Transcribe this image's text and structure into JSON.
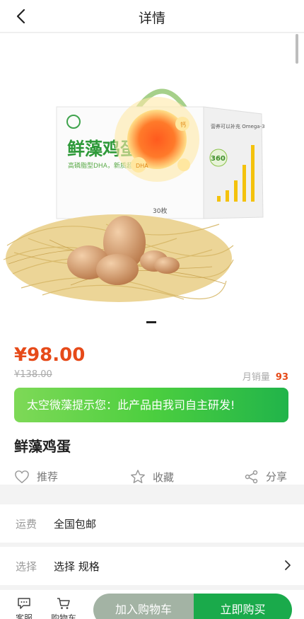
{
  "nav": {
    "title": "详情"
  },
  "product": {
    "price": "¥98.00",
    "old_price": "¥138.00",
    "sales_label": "月销量",
    "sales_count": "93",
    "notice": "太空微藻提示您：此产品由我司自主研发!",
    "name": "鲜藻鸡蛋"
  },
  "image_text": {
    "brand": "鲜藻鸡蛋",
    "tagline": "高磷脂型DHA，新质超黄金",
    "dha": "DHA",
    "calcium": "钙",
    "omega": "营养可以补充 Omega-3",
    "number": "360",
    "weight": "30枚"
  },
  "actions": {
    "recommend": "推荐",
    "favorite": "收藏",
    "share": "分享"
  },
  "shipping": {
    "label": "运费",
    "value": "全国包邮"
  },
  "spec": {
    "label": "选择",
    "value": "选择 规格"
  },
  "bottom": {
    "service": "客服",
    "cart": "购物车",
    "add_to_cart": "加入购物车",
    "buy_now": "立即购买"
  },
  "colors": {
    "accent": "#e64a19",
    "green": "#1aaa4b",
    "gray_btn": "#a3b3a4"
  }
}
